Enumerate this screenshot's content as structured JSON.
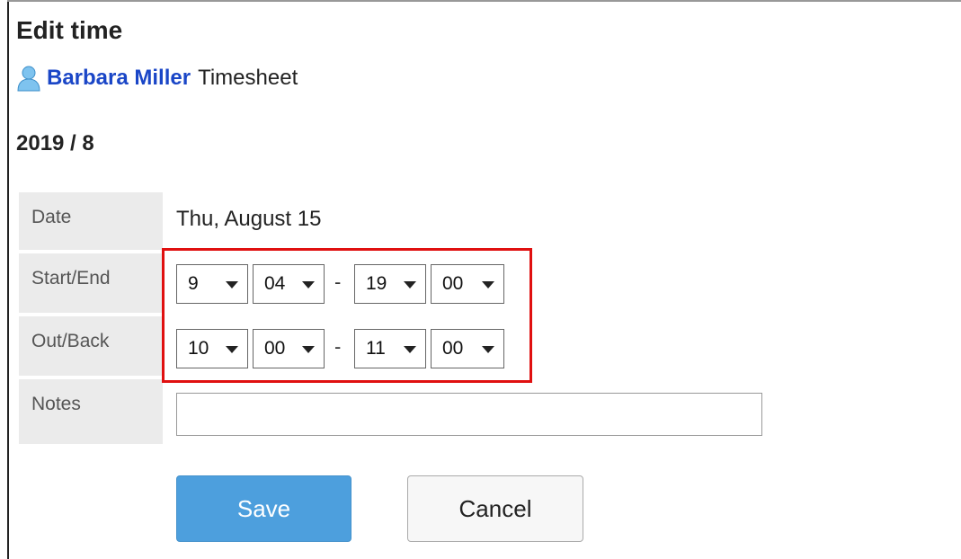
{
  "page": {
    "title": "Edit time"
  },
  "user": {
    "name": "Barbara Miller",
    "suffix": "Timesheet"
  },
  "period": {
    "label": "2019 / 8"
  },
  "form": {
    "date": {
      "label": "Date",
      "value": "Thu, August 15"
    },
    "start_end": {
      "label": "Start/End",
      "start_hour": "9",
      "start_minute": "04",
      "end_hour": "19",
      "end_minute": "00",
      "separator": "-"
    },
    "out_back": {
      "label": "Out/Back",
      "out_hour": "10",
      "out_minute": "00",
      "back_hour": "11",
      "back_minute": "00",
      "separator": "-"
    },
    "notes": {
      "label": "Notes",
      "value": "",
      "placeholder": ""
    }
  },
  "buttons": {
    "save": "Save",
    "cancel": "Cancel"
  },
  "colors": {
    "link": "#1a46c7",
    "save_button": "#4d9fdd",
    "highlight_border": "#e01010",
    "label_bg": "#ebebeb"
  },
  "icons": {
    "user": "user-icon",
    "dropdown": "chevron-down-icon"
  }
}
